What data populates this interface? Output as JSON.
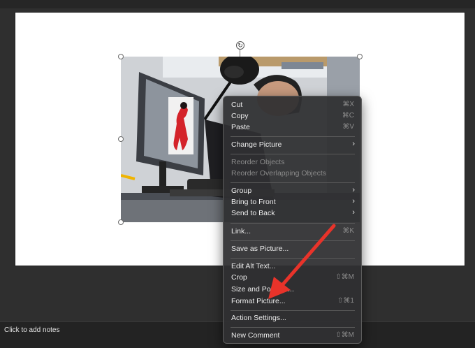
{
  "notes": {
    "placeholder": "Click to add notes"
  },
  "rotate_icon": "↻",
  "menu": {
    "items": [
      {
        "label": "Cut",
        "shortcut": "⌘X"
      },
      {
        "label": "Copy",
        "shortcut": "⌘C"
      },
      {
        "label": "Paste",
        "shortcut": "⌘V"
      },
      {
        "label": "Change Picture",
        "submenu": "›"
      },
      {
        "label": "Reorder Objects",
        "disabled": true
      },
      {
        "label": "Reorder Overlapping Objects",
        "disabled": true
      },
      {
        "label": "Group",
        "submenu": "›"
      },
      {
        "label": "Bring to Front",
        "submenu": "›"
      },
      {
        "label": "Send to Back",
        "submenu": "›"
      },
      {
        "label": "Link...",
        "shortcut": "⌘K"
      },
      {
        "label": "Save as Picture..."
      },
      {
        "label": "Edit Alt Text..."
      },
      {
        "label": "Crop",
        "shortcut": "⇧⌘M"
      },
      {
        "label": "Size and Position..."
      },
      {
        "label": "Format Picture...",
        "shortcut": "⇧⌘1"
      },
      {
        "label": "Action Settings..."
      },
      {
        "label": "New Comment",
        "shortcut": "⇧⌘M"
      }
    ]
  },
  "colors": {
    "arrow": "#e8332a",
    "menu_bg": "#303032",
    "slide_bg": "#ffffff"
  }
}
